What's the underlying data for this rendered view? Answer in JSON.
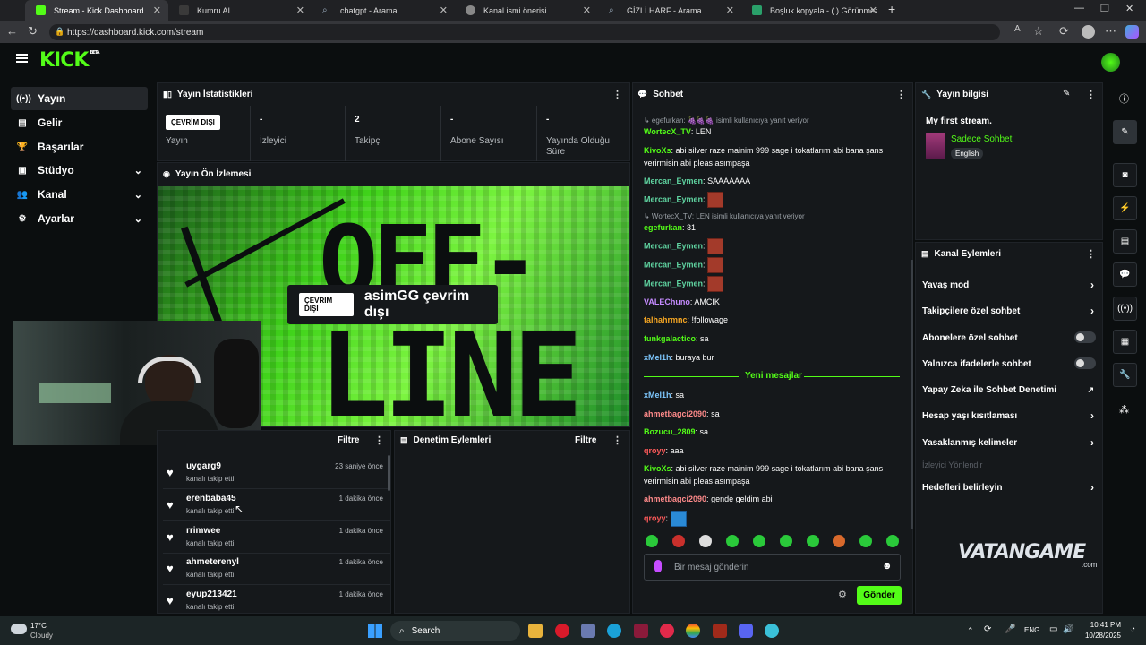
{
  "browser": {
    "tabs": [
      {
        "label": "Stream - Kick Dashboard",
        "color": "#53fc18"
      },
      {
        "label": "Kumru AI",
        "color": "#3a3a3a"
      },
      {
        "label": "chatgpt - Arama",
        "color": "#4a7fd6"
      },
      {
        "label": "Kanal ismi önerisi",
        "color": "#888"
      },
      {
        "label": "GİZLİ HARF - Arama",
        "color": "#4a7fd6"
      },
      {
        "label": "Boşluk kopyala - (  ) Görünmez Harf",
        "color": "#2aa06a"
      }
    ],
    "url": "https://dashboard.kick.com/stream"
  },
  "brand": {
    "logo": "KICK",
    "tag": "BETA",
    "accent": "#53fc18"
  },
  "sidebar": {
    "items": [
      {
        "label": "Yayın",
        "icon": "broadcast-icon"
      },
      {
        "label": "Gelir",
        "icon": "revenue-icon"
      },
      {
        "label": "Başarılar",
        "icon": "trophy-icon"
      },
      {
        "label": "Stüdyo",
        "icon": "studio-icon"
      },
      {
        "label": "Kanal",
        "icon": "channel-icon"
      },
      {
        "label": "Ayarlar",
        "icon": "gear-icon"
      }
    ]
  },
  "stats": {
    "title": "Yayın İstatistikleri",
    "status_badge": "ÇEVRİM DIŞI",
    "cells": [
      {
        "value": "",
        "label": "Yayın"
      },
      {
        "value": "-",
        "label": "İzleyici"
      },
      {
        "value": "2",
        "label": "Takipçi"
      },
      {
        "value": "-",
        "label": "Abone Sayısı"
      },
      {
        "value": "-",
        "label": "Yayında Olduğu Süre"
      }
    ]
  },
  "preview": {
    "title": "Yayın Ön İzlemesi",
    "big1": "OFF-",
    "big2": "LINE",
    "badge": "ÇEVRİM DIŞI",
    "text": "asimGG çevrim dışı"
  },
  "followers": {
    "filter": "Filtre",
    "rows": [
      {
        "name": "uygarg9",
        "sub": "kanalı takip etti",
        "time": "23 saniye önce"
      },
      {
        "name": "erenbaba45",
        "sub": "kanalı takip etti",
        "time": "1 dakika önce"
      },
      {
        "name": "rrimwee",
        "sub": "kanalı takip etti",
        "time": "1 dakika önce"
      },
      {
        "name": "ahmeterenyl",
        "sub": "kanalı takip etti",
        "time": "1 dakika önce"
      },
      {
        "name": "eyup213421",
        "sub": "kanalı takip etti",
        "time": "1 dakika önce"
      }
    ]
  },
  "moderation": {
    "title": "Denetim Eylemleri",
    "filter": "Filtre"
  },
  "chat": {
    "title": "Sohbet",
    "reply1": "↳ egefurkan: 🍇🍇🍇 isimli kullanıcıya yanıt veriyor",
    "reply2": "↳ WortecX_TV: LEN isimli kullanıcıya yanıt veriyor",
    "messages": [
      {
        "user": "WortecX_TV",
        "color": "#53fc18",
        "text": "LEN"
      },
      {
        "user": "KivoXs",
        "color": "#53fc18",
        "text": "abi silver raze mainim 999 sage i tokatlarım abi bana şans verirmisin abi pleas asımpaşa"
      },
      {
        "user": "Mercan_Eymen",
        "color": "#5fd3a0",
        "text": "SAAAAAAA"
      },
      {
        "user": "Mercan_Eymen",
        "color": "#5fd3a0",
        "text": ""
      },
      {
        "user": "egefurkan",
        "color": "#53fc18",
        "text": "31"
      },
      {
        "user": "Mercan_Eymen",
        "color": "#5fd3a0",
        "text": ""
      },
      {
        "user": "Mercan_Eymen",
        "color": "#5fd3a0",
        "text": ""
      },
      {
        "user": "Mercan_Eymen",
        "color": "#5fd3a0",
        "text": ""
      },
      {
        "user": "VALEChuno",
        "color": "#c58bff",
        "text": "AMCIK"
      },
      {
        "user": "talhahrmnc",
        "color": "#f5a623",
        "text": "!followage"
      },
      {
        "user": "funkgalactico",
        "color": "#53fc18",
        "text": "sa"
      },
      {
        "user": "xMel1h",
        "color": "#7ec8ff",
        "text": "buraya bur"
      }
    ],
    "divider": "Yeni mesajlar",
    "new_messages": [
      {
        "user": "xMel1h",
        "color": "#7ec8ff",
        "text": "sa"
      },
      {
        "user": "ahmetbagci2090",
        "color": "#ff8a8a",
        "text": "sa"
      },
      {
        "user": "Bozucu_2809",
        "color": "#53fc18",
        "text": "sa"
      },
      {
        "user": "qroyy",
        "color": "#ff5a5a",
        "text": "aaa"
      },
      {
        "user": "KivoXs",
        "color": "#53fc18",
        "text": "abi silver raze mainim 999 sage i tokatlarım abi bana şans verirmisin abi pleas asımpaşa"
      },
      {
        "user": "ahmetbagci2090",
        "color": "#ff8a8a",
        "text": "gende geldim abi"
      },
      {
        "user": "qroyy",
        "color": "#ff5a5a",
        "text": ""
      }
    ],
    "placeholder": "Bir mesaj gönderin",
    "send": "Gönder"
  },
  "stream_info": {
    "title": "Yayın bilgisi",
    "stream_title": "My first stream.",
    "category": "Sadece Sohbet",
    "language": "English"
  },
  "channel_actions": {
    "title": "Kanal Eylemleri",
    "items": [
      {
        "label": "Yavaş mod",
        "type": "arrow"
      },
      {
        "label": "Takipçilere özel sohbet",
        "type": "arrow"
      },
      {
        "label": "Abonelere özel sohbet",
        "type": "toggle"
      },
      {
        "label": "Yalnızca ifadelerle sohbet",
        "type": "toggle"
      },
      {
        "label": "Yapay Zeka ile Sohbet Denetimi",
        "type": "external"
      },
      {
        "label": "Hesap yaşı kısıtlaması",
        "type": "arrow"
      },
      {
        "label": "Yasaklanmış kelimeler",
        "type": "arrow"
      },
      {
        "label": "İzleyici Yönlendir",
        "type": "disabled"
      },
      {
        "label": "Hedefleri belirleyin",
        "type": "arrow"
      }
    ]
  },
  "watermark": {
    "text": "VATANGAME",
    "sub": ".com"
  },
  "taskbar": {
    "weather_temp": "17°C",
    "weather_desc": "Cloudy",
    "search": "Search",
    "lang": "ENG",
    "time": "10:41 PM",
    "date": "10/28/2025"
  }
}
